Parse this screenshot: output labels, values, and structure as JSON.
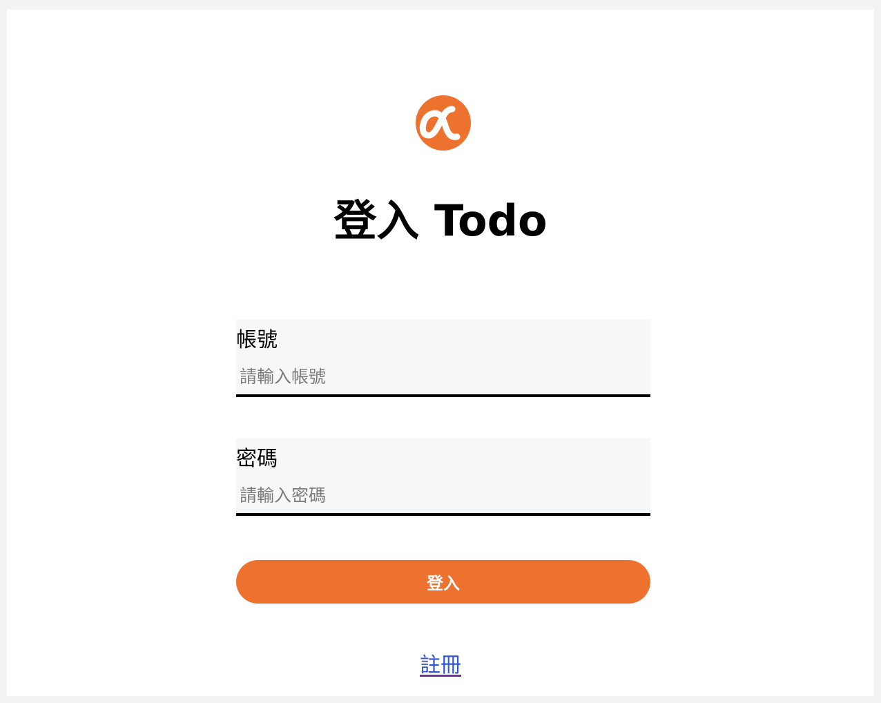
{
  "brand": {
    "logo_icon": "alpha-icon",
    "accent_color": "#ee722f"
  },
  "page": {
    "title": "登入 Todo"
  },
  "form": {
    "account": {
      "label": "帳號",
      "value": "",
      "placeholder": "請輸入帳號"
    },
    "password": {
      "label": "密碼",
      "value": "",
      "placeholder": "請輸入密碼"
    },
    "submit_label": "登入"
  },
  "footer": {
    "register_link": "註冊"
  }
}
